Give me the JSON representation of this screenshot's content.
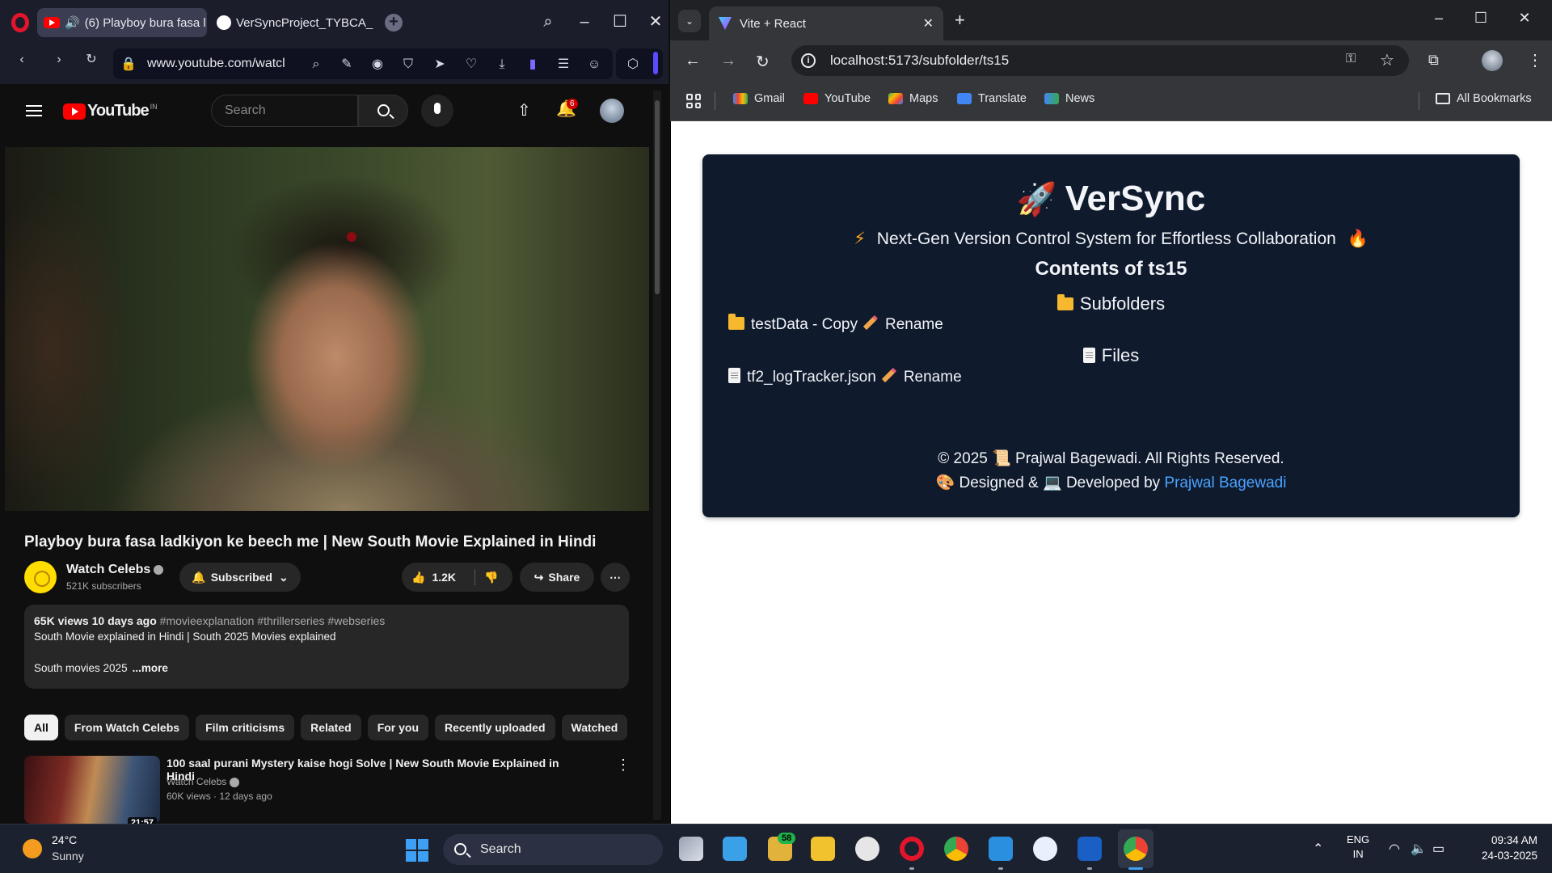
{
  "opera": {
    "tabs": [
      {
        "title": "(6) Playboy bura fasa l",
        "active": true
      },
      {
        "title": "VerSyncProject_TYBCA_SE",
        "active": false
      }
    ],
    "url": "www.youtube.com/watcl",
    "youtube": {
      "logo_text": "YouTube",
      "country": "IN",
      "search_placeholder": "Search",
      "notification_count": "6",
      "video_title": "Playboy bura fasa ladkiyon ke beech me | New South Movie Explained in Hindi",
      "channel_name": "Watch Celebs",
      "subscribers": "521K subscribers",
      "subscribe_label": "Subscribed",
      "likes": "1.2K",
      "share_label": "Share",
      "description": {
        "views": "65K views",
        "age": "10 days ago",
        "tags": "#movieexplanation #thrillerseries #webseries",
        "line2": "South Movie explained in Hindi | South 2025 Movies explained",
        "line3": "South movies 2025",
        "more": "...more"
      },
      "chips": [
        "All",
        "From Watch Celebs",
        "Film criticisms",
        "Related",
        "For you",
        "Recently uploaded",
        "Watched"
      ],
      "recommendation": {
        "title": "100 saal purani Mystery kaise hogi Solve | New South Movie Explained in Hindi",
        "channel": "Watch Celebs",
        "meta": "60K views · 12 days ago",
        "duration": "21:57"
      }
    }
  },
  "chrome": {
    "tab_title": "Vite + React",
    "url": "localhost:5173/subfolder/ts15",
    "bookmarks": [
      "Gmail",
      "YouTube",
      "Maps",
      "Translate",
      "News"
    ],
    "all_bookmarks": "All Bookmarks",
    "app": {
      "title": "VerSync",
      "tagline": "Next-Gen Version Control System for Effortless Collaboration",
      "contents_heading": "Contents of ts15",
      "subfolders_heading": "Subfolders",
      "subfolder_name": "testData - Copy",
      "rename_label": "Rename",
      "files_heading": "Files",
      "file_name": "tf2_logTracker.json",
      "footer_line1": "© 2025 📜 Prajwal Bagewadi. All Rights Reserved.",
      "footer_line2_prefix": "Designed & ",
      "footer_line2_mid": "Developed by ",
      "footer_author": "Prajwal Bagewadi"
    }
  },
  "taskbar": {
    "weather_temp": "24°C",
    "weather_desc": "Sunny",
    "search_label": "Search",
    "badge_count": "58",
    "lang_line1": "ENG",
    "lang_line2": "IN",
    "time": "09:34 AM",
    "date": "24-03-2025"
  }
}
